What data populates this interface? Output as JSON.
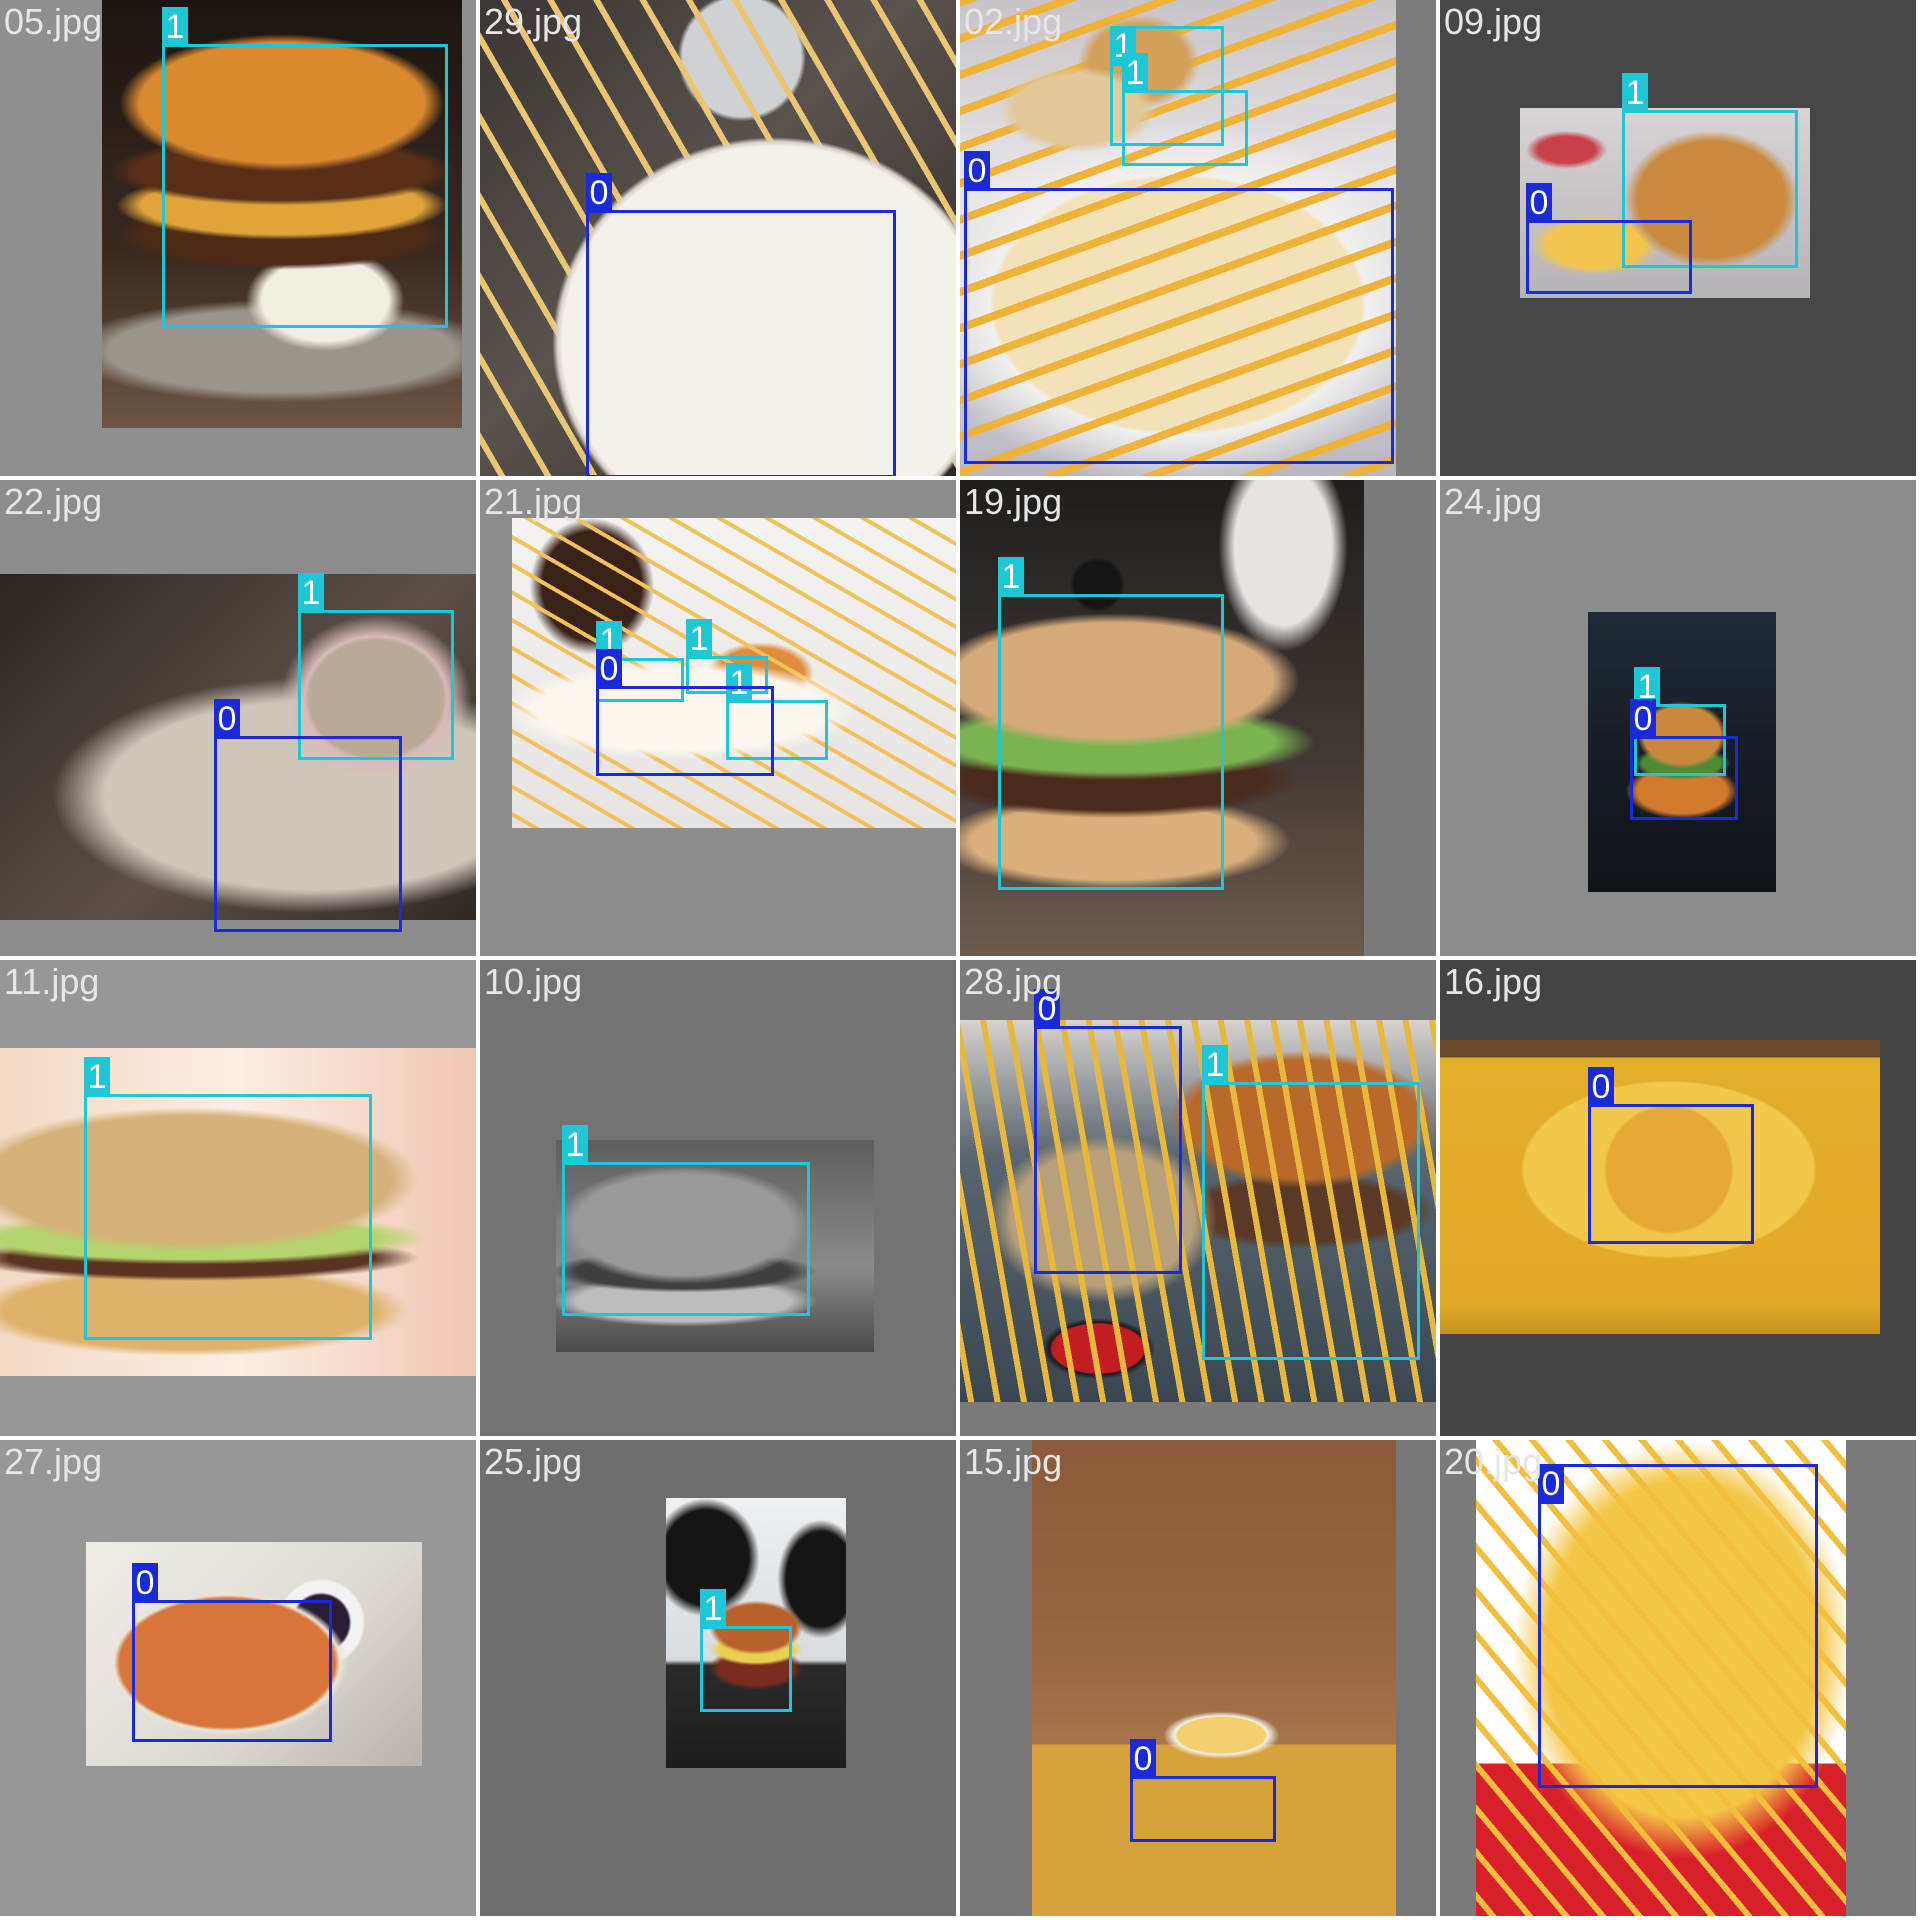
{
  "grid": {
    "rows": 4,
    "cols": 4
  },
  "classes": {
    "0": {
      "color": "#1a2ad9"
    },
    "1": {
      "color": "#1ec7d6"
    }
  },
  "cells": [
    {
      "file": "05.jpg",
      "bg": "#8f8f8f",
      "subject": "burger",
      "boxes": [
        {
          "cls": "1"
        }
      ]
    },
    {
      "file": "29.jpg",
      "bg": "#8f8f8f",
      "subject": "fries-plate",
      "boxes": [
        {
          "cls": "0"
        }
      ]
    },
    {
      "file": "02.jpg",
      "bg": "#7c7c7c",
      "subject": "fries-basket",
      "boxes": [
        {
          "cls": "1"
        },
        {
          "cls": "1"
        },
        {
          "cls": "0"
        }
      ]
    },
    {
      "file": "09.jpg",
      "bg": "#474747",
      "subject": "burger-fries",
      "boxes": [
        {
          "cls": "1"
        },
        {
          "cls": "0"
        }
      ]
    },
    {
      "file": "22.jpg",
      "bg": "#8c8c8c",
      "subject": "burger-fries-board",
      "boxes": [
        {
          "cls": "1"
        },
        {
          "cls": "0"
        }
      ]
    },
    {
      "file": "21.jpg",
      "bg": "#8c8c8c",
      "subject": "person-plate",
      "boxes": [
        {
          "cls": "1"
        },
        {
          "cls": "1"
        },
        {
          "cls": "1"
        },
        {
          "cls": "0"
        }
      ]
    },
    {
      "file": "19.jpg",
      "bg": "#7a7a7a",
      "subject": "burger-dark",
      "boxes": [
        {
          "cls": "1"
        }
      ]
    },
    {
      "file": "24.jpg",
      "bg": "#8c8c8c",
      "subject": "burger-small-dark",
      "boxes": [
        {
          "cls": "1"
        },
        {
          "cls": "0"
        }
      ]
    },
    {
      "file": "11.jpg",
      "bg": "#979797",
      "subject": "burger-bright",
      "boxes": [
        {
          "cls": "1"
        }
      ]
    },
    {
      "file": "10.jpg",
      "bg": "#737373",
      "subject": "burger-bw",
      "boxes": [
        {
          "cls": "1"
        }
      ]
    },
    {
      "file": "28.jpg",
      "bg": "#7a7a7a",
      "subject": "fries-cup-burger",
      "boxes": [
        {
          "cls": "0"
        },
        {
          "cls": "1"
        }
      ]
    },
    {
      "file": "16.jpg",
      "bg": "#444444",
      "subject": "fries-yellow-table",
      "boxes": [
        {
          "cls": "0"
        }
      ]
    },
    {
      "file": "27.jpg",
      "bg": "#979797",
      "subject": "sweet-fries",
      "boxes": [
        {
          "cls": "0"
        }
      ]
    },
    {
      "file": "25.jpg",
      "bg": "#6e6e6e",
      "subject": "burger-gloves",
      "boxes": [
        {
          "cls": "1"
        }
      ]
    },
    {
      "file": "15.jpg",
      "bg": "#777777",
      "subject": "fries-box",
      "boxes": [
        {
          "cls": "0"
        }
      ]
    },
    {
      "file": "20.jpg",
      "bg": "#7a7a7a",
      "subject": "fries-red-carton",
      "boxes": [
        {
          "cls": "0"
        }
      ]
    }
  ]
}
